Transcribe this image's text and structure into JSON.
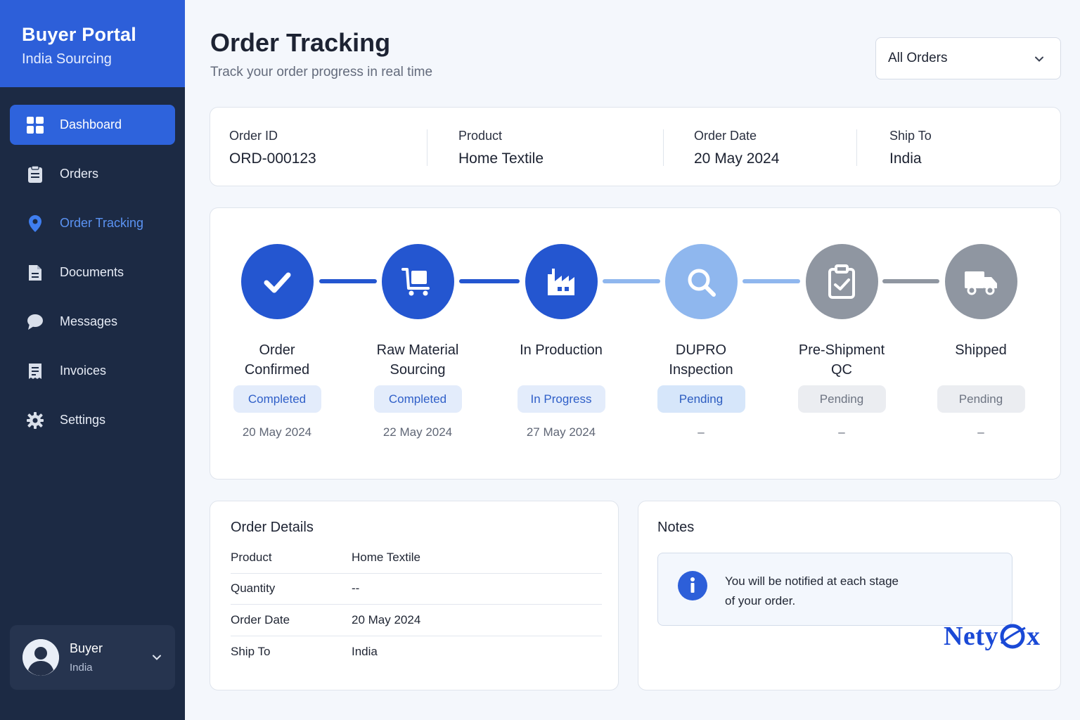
{
  "brand": {
    "title": "Buyer Portal",
    "subtitle": "India Sourcing"
  },
  "nav": [
    {
      "label": "Dashboard",
      "icon": "dashboard-icon",
      "state": "active"
    },
    {
      "label": "Orders",
      "icon": "clipboard-icon",
      "state": "normal"
    },
    {
      "label": "Order Tracking",
      "icon": "location-pin-icon",
      "state": "current"
    },
    {
      "label": "Documents",
      "icon": "document-icon",
      "state": "normal"
    },
    {
      "label": "Messages",
      "icon": "chat-bubble-icon",
      "state": "normal"
    },
    {
      "label": "Invoices",
      "icon": "invoice-icon",
      "state": "normal"
    },
    {
      "label": "Settings",
      "icon": "gear-icon",
      "state": "normal"
    }
  ],
  "user": {
    "name": "Buyer",
    "location": "India"
  },
  "header": {
    "title": "Order Tracking",
    "subtitle": "Track your order progress in real time",
    "filter_value": "All Orders"
  },
  "summary": [
    {
      "label": "Order ID",
      "value": "ORD-000123"
    },
    {
      "label": "Product",
      "value": "Home Textile"
    },
    {
      "label": "Order Date",
      "value": "20 May 2024"
    },
    {
      "label": "Ship To",
      "value": "India"
    }
  ],
  "steps": [
    {
      "name_line1": "Order",
      "name_line2": "Confirmed",
      "status": "Completed",
      "date": "20 May 2024",
      "icon": "check-icon"
    },
    {
      "name_line1": "Raw Material",
      "name_line2": "Sourcing",
      "status": "Completed",
      "date": "22 May 2024",
      "icon": "cart-icon"
    },
    {
      "name_line1": "In Production",
      "name_line2": "",
      "status": "In Progress",
      "date": "27 May 2024",
      "icon": "factory-icon"
    },
    {
      "name_line1": "DUPRO",
      "name_line2": "Inspection",
      "status": "Pending",
      "date": "–",
      "icon": "search-icon"
    },
    {
      "name_line1": "Pre-Shipment",
      "name_line2": "QC",
      "status": "Pending",
      "date": "–",
      "icon": "clipboard-check-icon"
    },
    {
      "name_line1": "Shipped",
      "name_line2": "",
      "status": "Pending",
      "date": "–",
      "icon": "truck-icon"
    }
  ],
  "colors": {
    "primary": "#2d5fd9",
    "step_active": "#2456d0",
    "step_next": "#8fb7ee",
    "step_pending": "#8f96a1",
    "sidebar": "#1c2a44",
    "link_current": "#5b93f3"
  },
  "details": {
    "title": "Order Details",
    "rows": [
      {
        "key": "Product",
        "value": "Home Textile"
      },
      {
        "key": "Quantity",
        "value": "--"
      },
      {
        "key": "Order Date",
        "value": "20 May 2024"
      },
      {
        "key": "Ship To",
        "value": "India"
      }
    ]
  },
  "notes": {
    "title": "Notes",
    "line1": "You will be notified at each stage",
    "line2": "of your order.",
    "logo_left": "Nety",
    "logo_right": "x"
  }
}
